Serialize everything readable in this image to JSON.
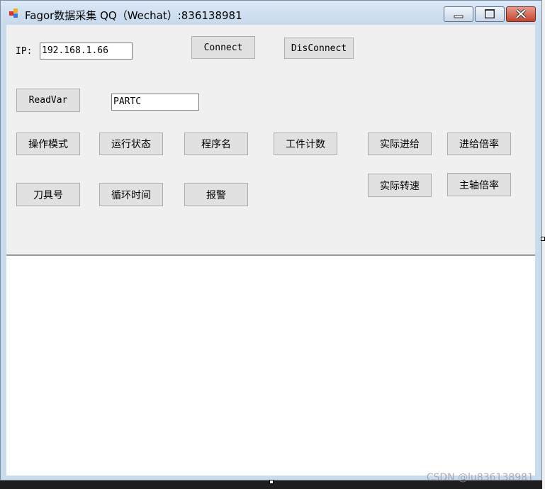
{
  "window": {
    "title": "Fagor数据采集 QQ（Wechat）:836138981"
  },
  "connection": {
    "ip_label": "IP:",
    "ip_value": "192.168.1.66",
    "connect_label": "Connect",
    "disconnect_label": "DisConnect"
  },
  "readvar": {
    "button_label": "ReadVar",
    "var_value": "PARTC"
  },
  "buttons": {
    "operation_mode": "操作模式",
    "run_status": "运行状态",
    "program_name": "程序名",
    "workpiece_count": "工件计数",
    "actual_feed": "实际进给",
    "feed_override": "进给倍率",
    "tool_number": "刀具号",
    "cycle_time": "循环时间",
    "alarm": "报警",
    "actual_speed": "实际转速",
    "spindle_override": "主轴倍率"
  },
  "watermark": "CSDN @lu836138981",
  "colors": {
    "client_bg": "#f0f0f0",
    "button_bg": "#e1e1e1",
    "titlebar": "#c7d9ec",
    "close_button": "#c3452e"
  }
}
